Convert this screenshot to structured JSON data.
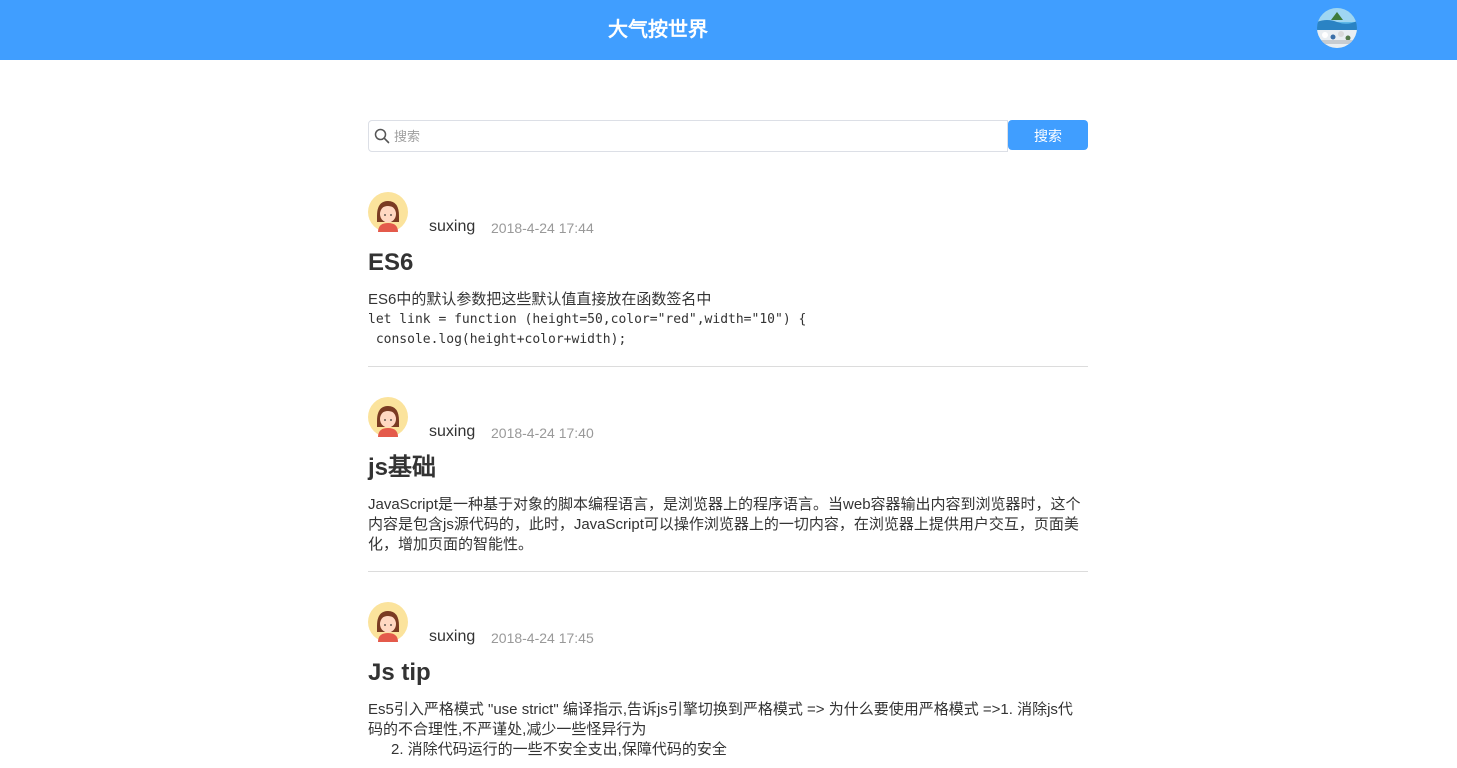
{
  "header": {
    "title": "大气按世界",
    "background_color": "#409eff",
    "avatar_icon": "user-avatar-icon"
  },
  "search": {
    "placeholder": "搜索",
    "value": "",
    "button_label": "搜索",
    "icon": "search-icon"
  },
  "posts": [
    {
      "author": "suxing",
      "time": "2018-4-24 17:44",
      "title": "ES6",
      "body_text": "ES6中的默认参数把这些默认值直接放在函数签名中",
      "code_lines": [
        "let link = function (height=50,color=\"red\",width=\"10\") {",
        " console.log(height+color+width);"
      ]
    },
    {
      "author": "suxing",
      "time": "2018-4-24 17:40",
      "title": "js基础",
      "body_text": "JavaScript是一种基于对象的脚本编程语言，是浏览器上的程序语言。当web容器输出内容到浏览器时，这个内容是包含js源代码的，此时，JavaScript可以操作浏览器上的一切内容，在浏览器上提供用户交互，页面美化，增加页面的智能性。"
    },
    {
      "author": "suxing",
      "time": "2018-4-24 17:45",
      "title": "Js tip",
      "body_text": "Es5引入严格模式 \"use strict\" 编译指示,告诉js引擎切换到严格模式 => 为什么要使用严格模式 =>1. 消除js代码的不合理性,不严谨处,减少一些怪异行为",
      "list_line": "2.  消除代码运行的一些不安全支出,保障代码的安全"
    }
  ]
}
